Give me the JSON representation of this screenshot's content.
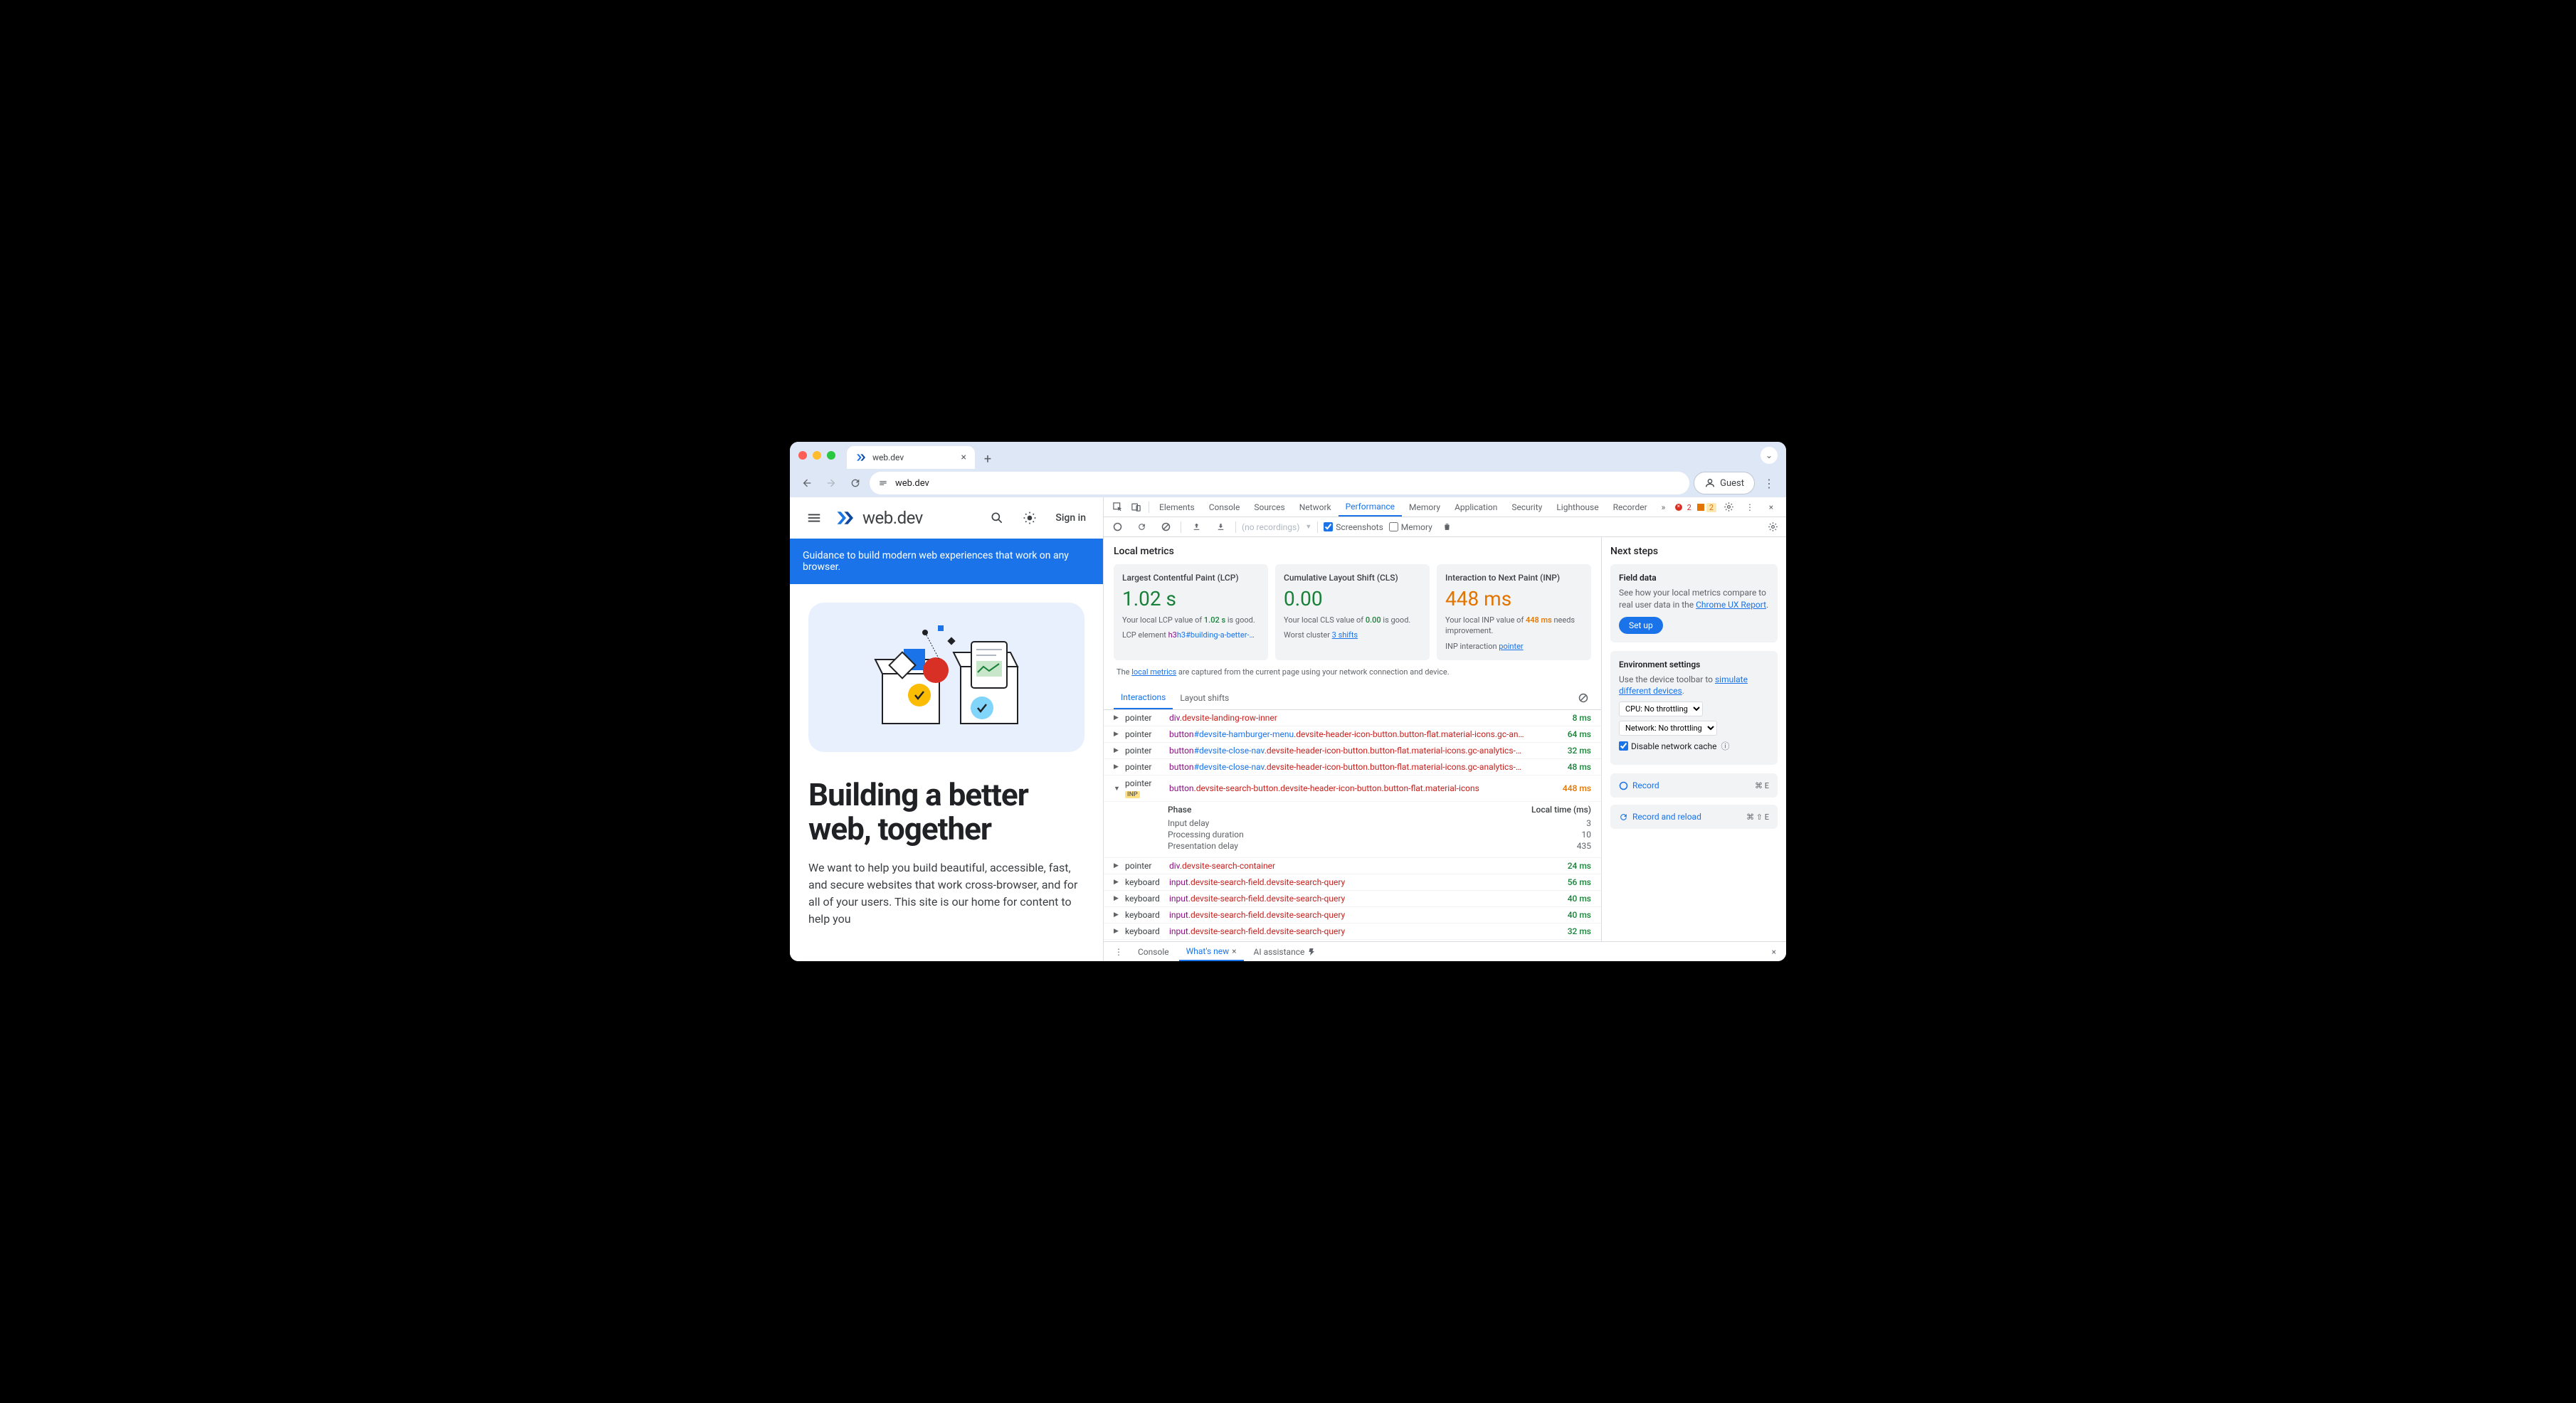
{
  "browser": {
    "tab_title": "web.dev",
    "url": "web.dev",
    "guest_label": "Guest"
  },
  "page": {
    "brand": "web.dev",
    "signin": "Sign in",
    "banner": "Guidance to build modern web experiences that work on any browser.",
    "hero_title": "Building a better web, together",
    "hero_body": "We want to help you build beautiful, accessible, fast, and secure websites that work cross-browser, and for all of your users. This site is our home for content to help you"
  },
  "devtools": {
    "tabs": [
      "Elements",
      "Console",
      "Sources",
      "Network",
      "Performance",
      "Memory",
      "Application",
      "Security",
      "Lighthouse",
      "Recorder"
    ],
    "active_tab": "Performance",
    "errors": "2",
    "warnings": "2",
    "toolbar": {
      "recordings": "(no recordings)",
      "screenshots": "Screenshots",
      "memory": "Memory"
    },
    "local_metrics_title": "Local metrics",
    "metrics": {
      "lcp": {
        "title": "Largest Contentful Paint (LCP)",
        "value": "1.02 s",
        "sub1_a": "Your local LCP value of ",
        "sub1_v": "1.02 s",
        "sub1_b": " is good.",
        "sub2_a": "LCP element ",
        "sub2_link": "h3#building-a-better-…"
      },
      "cls": {
        "title": "Cumulative Layout Shift (CLS)",
        "value": "0.00",
        "sub1_a": "Your local CLS value of ",
        "sub1_v": "0.00",
        "sub1_b": " is good.",
        "sub2_a": "Worst cluster ",
        "sub2_link": "3 shifts"
      },
      "inp": {
        "title": "Interaction to Next Paint (INP)",
        "value": "448 ms",
        "sub1_a": "Your local INP value of ",
        "sub1_v": "448 ms",
        "sub1_b": " needs improvement.",
        "sub2_a": "INP interaction ",
        "sub2_link": "pointer"
      }
    },
    "note_a": "The ",
    "note_link": "local metrics",
    "note_b": " are captured from the current page using your network connection and device.",
    "subtabs": {
      "a": "Interactions",
      "b": "Layout shifts"
    },
    "interactions": [
      {
        "kind": "pointer",
        "tag": "div",
        "cls": ".devsite-landing-row-inner",
        "ms": "8 ms"
      },
      {
        "kind": "pointer",
        "tag": "button",
        "id": "#devsite-hamburger-menu",
        "cls": ".devsite-header-icon-button.button-flat.material-icons.gc-an…",
        "ms": "64 ms"
      },
      {
        "kind": "pointer",
        "tag": "button",
        "id": "#devsite-close-nav",
        "cls": ".devsite-header-icon-button.button-flat.material-icons.gc-analytics-…",
        "ms": "32 ms"
      },
      {
        "kind": "pointer",
        "tag": "button",
        "id": "#devsite-close-nav",
        "cls": ".devsite-header-icon-button.button-flat.material-icons.gc-analytics-…",
        "ms": "48 ms"
      },
      {
        "kind": "pointer",
        "inp": "INP",
        "tag": "button",
        "cls": ".devsite-search-button.devsite-header-icon-button.button-flat.material-icons",
        "ms": "448 ms",
        "ni": true,
        "expanded": true
      },
      {
        "kind": "pointer",
        "tag": "div",
        "cls": ".devsite-search-container",
        "ms": "24 ms"
      },
      {
        "kind": "keyboard",
        "tag": "input",
        "cls": ".devsite-search-field.devsite-search-query",
        "ms": "56 ms"
      },
      {
        "kind": "keyboard",
        "tag": "input",
        "cls": ".devsite-search-field.devsite-search-query",
        "ms": "40 ms"
      },
      {
        "kind": "keyboard",
        "tag": "input",
        "cls": ".devsite-search-field.devsite-search-query",
        "ms": "40 ms"
      },
      {
        "kind": "keyboard",
        "tag": "input",
        "cls": ".devsite-search-field.devsite-search-query",
        "ms": "32 ms"
      }
    ],
    "phase": {
      "title": "Phase",
      "col": "Local time (ms)",
      "rows": [
        {
          "k": "Input delay",
          "v": "3"
        },
        {
          "k": "Processing duration",
          "v": "10"
        },
        {
          "k": "Presentation delay",
          "v": "435"
        }
      ]
    },
    "side": {
      "next": "Next steps",
      "field_h": "Field data",
      "field_p_a": "See how your local metrics compare to real user data in the ",
      "field_link": "Chrome UX Report",
      "setup": "Set up",
      "env_h": "Environment settings",
      "env_p_a": "Use the device toolbar to ",
      "env_link": "simulate different devices",
      "cpu": "CPU: No throttling",
      "net": "Network: No throttling",
      "disable_cache": "Disable network cache",
      "record": "Record",
      "record_k": "⌘ E",
      "reload": "Record and reload",
      "reload_k": "⌘ ⇧ E"
    },
    "drawer": {
      "console": "Console",
      "whatsnew": "What's new",
      "ai": "AI assistance"
    }
  }
}
